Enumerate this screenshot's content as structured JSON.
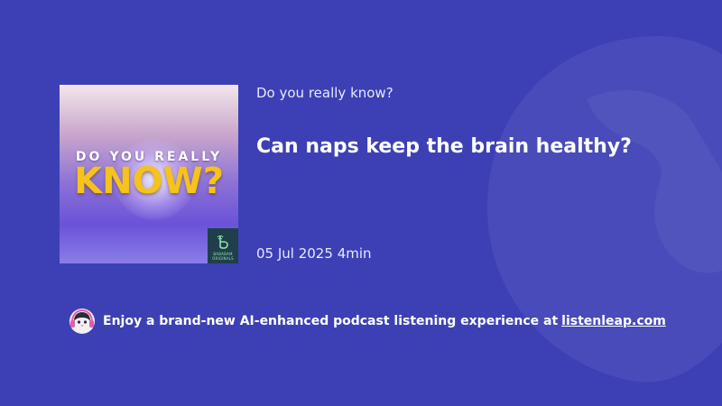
{
  "podcast": {
    "show_name": "Do you really know?",
    "episode_title": "Can naps keep the brain healthy?",
    "date": "05 Jul 2025",
    "duration": "4min"
  },
  "artwork": {
    "line1": "DO YOU REALLY",
    "line2": "KNOW?",
    "brand_line1": "BABABAM",
    "brand_line2": "ORIGINALS"
  },
  "promo": {
    "text": "Enjoy a brand-new AI-enhanced podcast listening experience at",
    "link": "listenleap.com",
    "icon": "penguin-headphones-icon"
  },
  "colors": {
    "background": "#3d40b5",
    "artwork_yellow": "#f6c21c"
  }
}
